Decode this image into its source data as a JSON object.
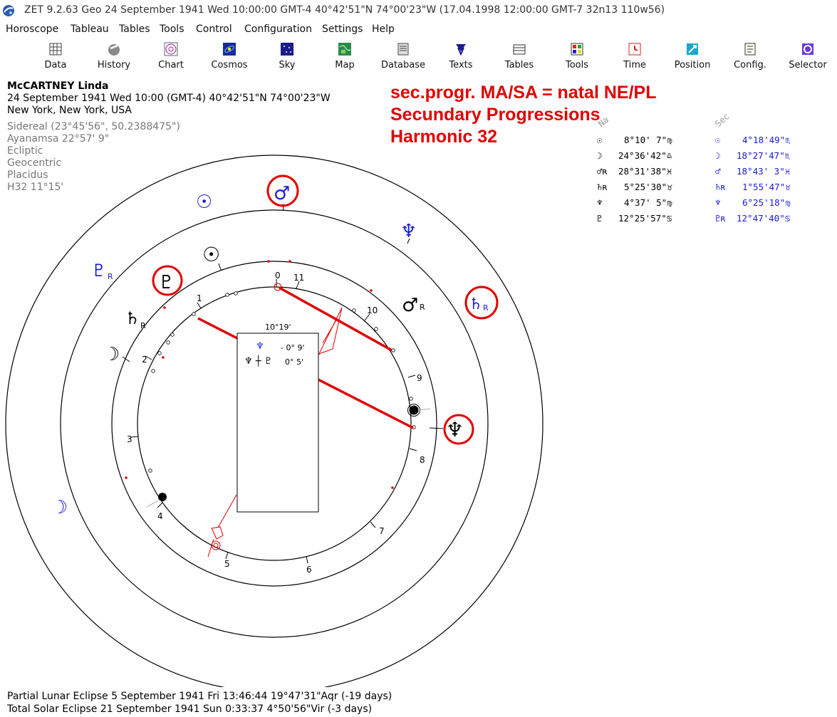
{
  "window": {
    "title": "ZET 9.2.63 Geo   24 September 1941  Wed  10:00:00 GMT-4 40°42'51\"N  74°00'23\"W  (17.04.1998  12:00:00 GMT-7 32n13 110w56)"
  },
  "menu": {
    "items": [
      "Horoscope",
      "Tableau",
      "Tables",
      "Tools",
      "Control",
      "Configuration",
      "Settings",
      "Help"
    ]
  },
  "toolbar": {
    "buttons": [
      "Data",
      "History",
      "Chart",
      "Cosmos",
      "Sky",
      "Map",
      "Database",
      "Texts",
      "Tables",
      "Tools",
      "Time",
      "Position",
      "Config.",
      "Selector"
    ]
  },
  "info": {
    "name": "McCARTNEY Linda",
    "date_line": "24 September 1941  Wed  10:00 (GMT-4) 40°42'51\"N  74°00'23\"W",
    "place": "New York, New York, USA",
    "settings": [
      "Sidereal (23°45'56\", 50.2388475\")",
      "Ayanamsa 22°57' 9\"",
      "Ecliptic",
      "Geocentric",
      "Placidus",
      "H32  11°15'"
    ]
  },
  "headline": {
    "line1": "sec.progr. MA/SA = natal NE/PL",
    "line2": "Secundary Progressions",
    "line3": "Harmonic 32"
  },
  "positions": {
    "header_natal": "Na",
    "header_sec": "Sec",
    "rows": [
      {
        "natal_glyph": "☉",
        "natal_value": "8°10' 7\"♍",
        "sec_glyph": "☉",
        "sec_value": "4°18'49\"♏"
      },
      {
        "natal_glyph": "☽",
        "natal_value": "24°36'42\"♎",
        "sec_glyph": "☽",
        "sec_value": "18°27'47\"♏"
      },
      {
        "natal_glyph": "♂ʀ",
        "natal_value": "28°31'38\"♓",
        "sec_glyph": "♂",
        "sec_value": "18°43' 3\"♓"
      },
      {
        "natal_glyph": "♄ʀ",
        "natal_value": "5°25'30\"♉",
        "sec_glyph": "♄ʀ",
        "sec_value": "1°55'47\"♉"
      },
      {
        "natal_glyph": "♆",
        "natal_value": "4°37' 5\"♍",
        "sec_glyph": "♆",
        "sec_value": "6°25'18\"♍"
      },
      {
        "natal_glyph": "♇",
        "natal_value": "12°25'57\"♋",
        "sec_glyph": "♇ʀ",
        "sec_value": "12°47'40\"♋"
      }
    ]
  },
  "chart": {
    "house_numbers": [
      "0",
      "11",
      "10",
      "9",
      "8",
      "7",
      "6",
      "5",
      "4",
      "3",
      "2",
      "1"
    ],
    "center_box": {
      "degree": "10°19'",
      "line1_glyph": "♆",
      "line1_value": "- 0° 9'",
      "line2_glyphs": "♆ ┼ ♇",
      "line2_value": "0° 5'"
    },
    "outer_glyphs": {
      "sun": "☉",
      "mars": "♂",
      "neptune": "♆",
      "pluto": "♇",
      "saturn": "♄",
      "moon": "☽",
      "retro": "R"
    },
    "colors": {
      "red": "#e00000",
      "blue": "#1a1ad8"
    }
  },
  "footer": {
    "line1": "Partial Lunar Eclipse 5 September 1941 Fri 13:46:44 19°47'31\"Aqr (-19 days)",
    "line2": "Total Solar Eclipse 21 September 1941 Sun  0:33:37  4°50'56\"Vir (-3 days)"
  }
}
